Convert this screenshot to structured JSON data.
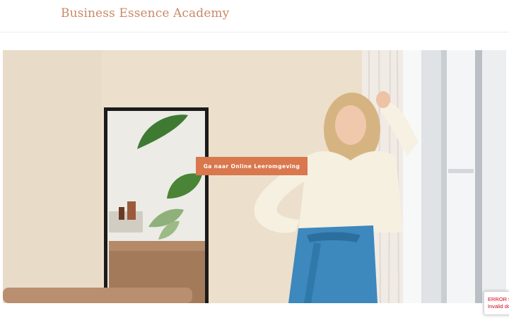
{
  "header": {
    "logo_text": "Business Essence Academy",
    "logo_color": "#c98967"
  },
  "hero": {
    "cta_label": "Ga naar Online Leeromgeving",
    "cta_color": "#d9774d"
  },
  "recaptcha": {
    "error_line": "ERROR fo",
    "invalid_line": "Invalid do",
    "text_color": "#d0021b"
  }
}
